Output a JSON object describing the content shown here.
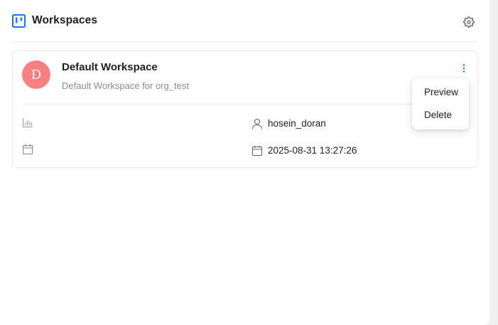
{
  "header": {
    "title": "Workspaces",
    "logo_icon": "kanban-board-icon",
    "settings_icon": "gear-icon"
  },
  "workspace": {
    "avatar_letter": "D",
    "avatar_color": "#f98080",
    "name": "Default Workspace",
    "description": "Default Workspace for org_test",
    "more_icon": "vertical-dots-icon",
    "owner": "hosein_doran",
    "created": "2025-08-31 13:27:26",
    "stats_icon": "bar-chart-icon",
    "calendar_icon": "calendar-icon",
    "user_icon": "user-icon"
  },
  "menu": {
    "items": [
      {
        "label": "Preview"
      },
      {
        "label": "Delete"
      }
    ]
  },
  "colors": {
    "accent": "#1677ff",
    "panel_bg": "#ffffff",
    "page_bg": "#f0f0f0"
  }
}
